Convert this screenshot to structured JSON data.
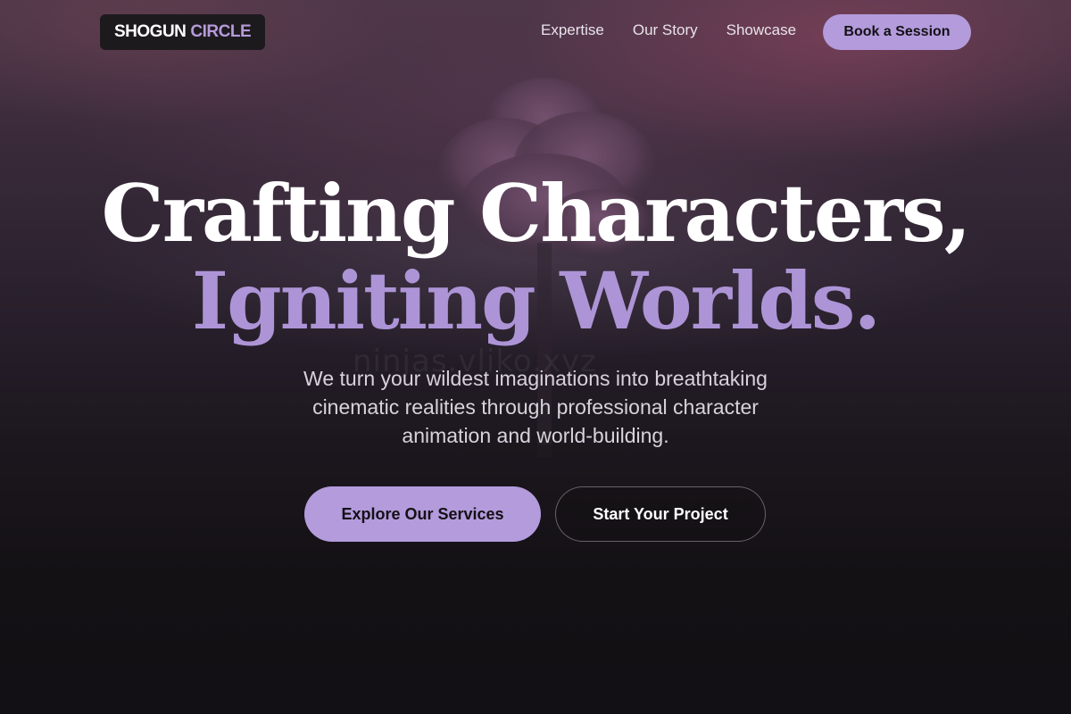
{
  "header": {
    "logo": {
      "part1": "SHOGUN",
      "part2": "CIRCLE"
    },
    "nav": [
      {
        "label": "Expertise"
      },
      {
        "label": "Our Story"
      },
      {
        "label": "Showcase"
      }
    ],
    "cta_label": "Book a Session"
  },
  "hero": {
    "title_line1": "Crafting Characters,",
    "title_line2": "Igniting Worlds.",
    "subtitle": "We turn your wildest imaginations into breathtaking cinematic realities through professional character animation and world-building.",
    "primary_button": "Explore Our Services",
    "secondary_button": "Start Your Project"
  },
  "background": {
    "watermark": "ninjas.vliko.xyz",
    "image_subject": "tree-in-fog"
  },
  "colors": {
    "accent": "#b39bdc",
    "title_accent": "#ad94d6",
    "background": "#121014",
    "text": "#ffffff"
  }
}
